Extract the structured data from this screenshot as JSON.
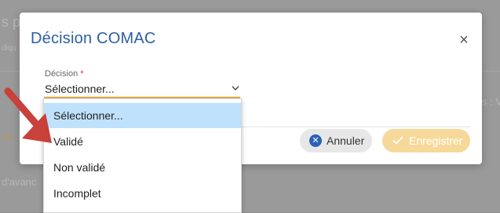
{
  "background": {
    "fragments": [
      "s p",
      "diqu",
      "s : V",
      "on",
      "d'avanc"
    ]
  },
  "modal": {
    "title": "Décision COMAC",
    "close_label": "×",
    "field": {
      "label": "Décision",
      "required_mark": "*",
      "value": "Sélectionner..."
    },
    "buttons": {
      "cancel": "Annuler",
      "save": "Enregistrer"
    }
  },
  "dropdown": {
    "options": [
      "Sélectionner...",
      "Validé",
      "Non validé",
      "Incomplet"
    ],
    "selected_index": 0
  },
  "colors": {
    "title": "#2d5fa3",
    "accent": "#e3b24a",
    "save_button": "#f6d99a",
    "highlight": "#bfe1fb",
    "arrow": "#c8413a"
  }
}
